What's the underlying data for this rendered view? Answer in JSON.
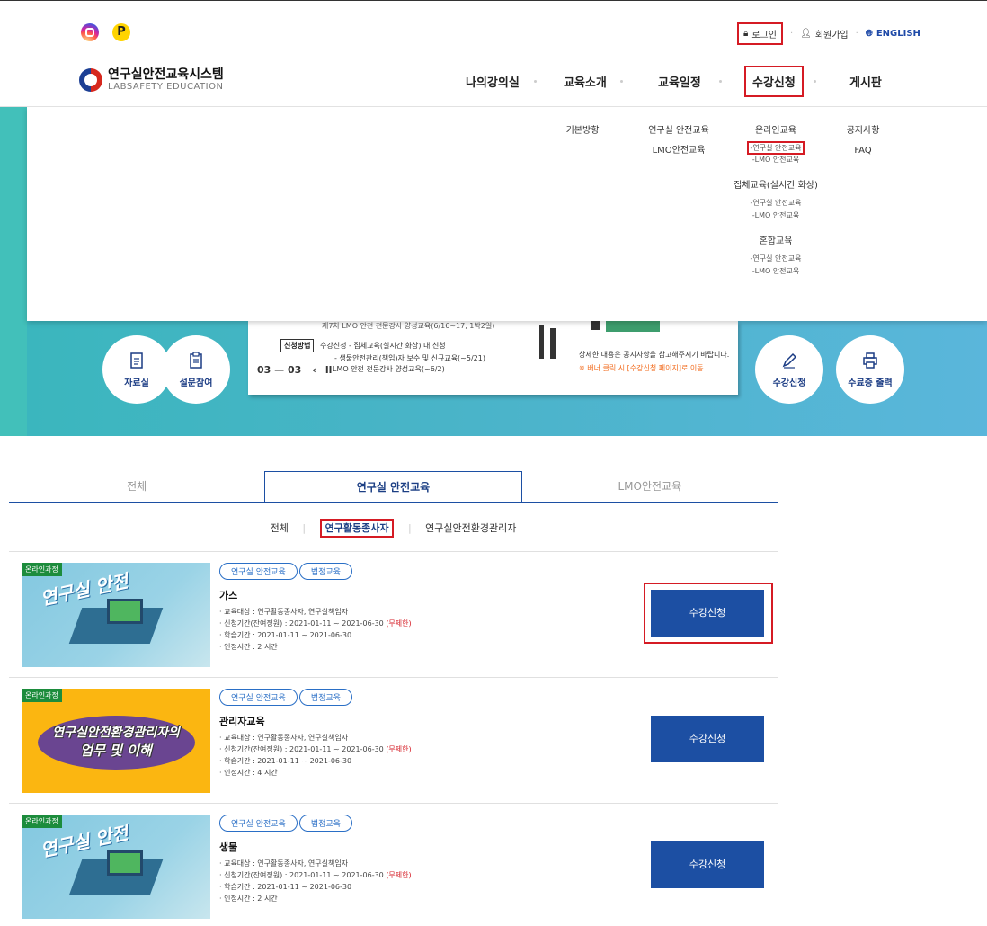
{
  "utility": {
    "login": "로그인",
    "signup": "회원가입",
    "english": "ENGLISH"
  },
  "logo": {
    "kr": "연구실안전교육시스템",
    "en": "LABSAFETY EDUCATION"
  },
  "menu": [
    "나의강의실",
    "교육소개",
    "교육일정",
    "수강신청",
    "게시판"
  ],
  "dropdown": {
    "col1": [
      "기본방향"
    ],
    "col2": [
      "연구실 안전교육",
      "LMO안전교육"
    ],
    "col3": {
      "online_head": "온라인교육",
      "online_items": [
        "-연구실 안전교육",
        "-LMO 안전교육"
      ],
      "group_head": "집체교육(실시간 화상)",
      "group_items": [
        "-연구실 안전교육",
        "-LMO 안전교육"
      ],
      "mixed_head": "혼합교육",
      "mixed_items": [
        "-연구실 안전교육",
        "-LMO 안전교육"
      ]
    },
    "col4": [
      "공지사항",
      "FAQ"
    ]
  },
  "hero": {
    "quick_left": [
      "자료실",
      "설문참여"
    ],
    "quick_right": [
      "수강신청",
      "수료증 출력"
    ],
    "banner": {
      "top_line": "제7차 LMO 안전 전문강사 양성교육(6/16~17, 1박2일)",
      "tag": "신청방법",
      "line1": "수강신청 - 집체교육(실시간 화상) 내 신청",
      "line2": "- 생물안전관리(책임)자 보수 및 신규교육(~5/21)",
      "line3": "LMO 안전 전문강사 양성교육(~6/2)",
      "pager": "03 — 03",
      "right1": "상세한 내용은 공지사항을 참고해주시기 바랍니다.",
      "right2": "※ 배너 클릭 시 [수강신청 페이지]로 이동"
    }
  },
  "tabs": [
    "전체",
    "연구실 안전교육",
    "LMO안전교육"
  ],
  "subtabs": [
    "전체",
    "연구활동종사자",
    "연구실안전환경관리자"
  ],
  "courses": [
    {
      "tag": "온라인과정",
      "thumb_text": "연구실 안전",
      "badges": [
        "연구실 안전교육",
        "법정교육"
      ],
      "title": "가스",
      "target": "· 교육대상 : 연구활동종사자, 연구실책임자",
      "period_prefix": "· 신청기간(잔여정원) : 2021-01-11 ~ 2021-06-30",
      "period_red": "(무제한)",
      "study": "· 학습기간 : 2021-01-11 ~ 2021-06-30",
      "hours": "· 인정시간 : 2 시간",
      "button": "수강신청"
    },
    {
      "tag": "온라인과정",
      "thumb_text": "연구실안전환경관리자의",
      "thumb_text2": "업무 및 이해",
      "badges": [
        "연구실 안전교육",
        "법정교육"
      ],
      "title": "관리자교육",
      "target": "· 교육대상 : 연구활동종사자, 연구실책임자",
      "period_prefix": "· 신청기간(잔여정원) : 2021-01-11 ~ 2021-06-30",
      "period_red": "(무제한)",
      "study": "· 학습기간 : 2021-01-11 ~ 2021-06-30",
      "hours": "· 인정시간 : 4 시간",
      "button": "수강신청"
    },
    {
      "tag": "온라인과정",
      "thumb_text": "연구실 안전",
      "badges": [
        "연구실 안전교육",
        "법정교육"
      ],
      "title": "생물",
      "target": "· 교육대상 : 연구활동종사자, 연구실책임자",
      "period_prefix": "· 신청기간(잔여정원) : 2021-01-11 ~ 2021-06-30",
      "period_red": "(무제한)",
      "study": "· 학습기간 : 2021-01-11 ~ 2021-06-30",
      "hours": "· 인정시간 : 2 시간",
      "button": "수강신청"
    }
  ],
  "colors": {
    "primary": "#1c4fa3",
    "highlight": "#d51b24",
    "hero": "#49b4c8"
  }
}
